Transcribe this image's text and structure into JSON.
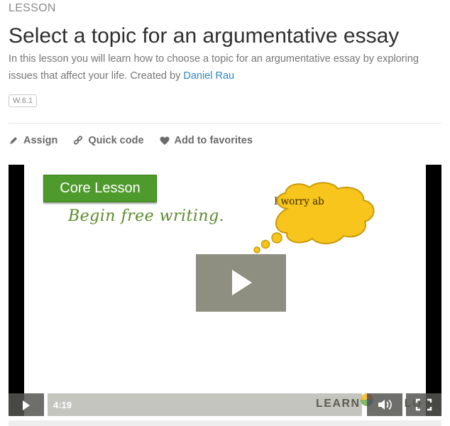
{
  "header": {
    "kicker": "LESSON",
    "title": "Select a topic for an argumentative essay",
    "description": "In this lesson you will learn how to choose a topic for an argumentative essay by exploring issues that affect your life. Created by ",
    "author": "Daniel Rau",
    "standard_badge": "W.6.1"
  },
  "actions": [
    {
      "label": "Assign",
      "icon": "pencil-icon"
    },
    {
      "label": "Quick code",
      "icon": "link-icon"
    },
    {
      "label": "Add to favorites",
      "icon": "heart-icon"
    }
  ],
  "video": {
    "frame": {
      "core_label": "Core Lesson",
      "scribble_text": "Begin free writing.",
      "bubble_text": "I worry ab"
    },
    "controls": {
      "duration": "4:19",
      "brand_left": "LEARN",
      "brand_right": "LO"
    }
  },
  "colors": {
    "link": "#2f86c6",
    "core_green": "#4e9a2c",
    "bubble_yellow": "#f7c51c"
  }
}
